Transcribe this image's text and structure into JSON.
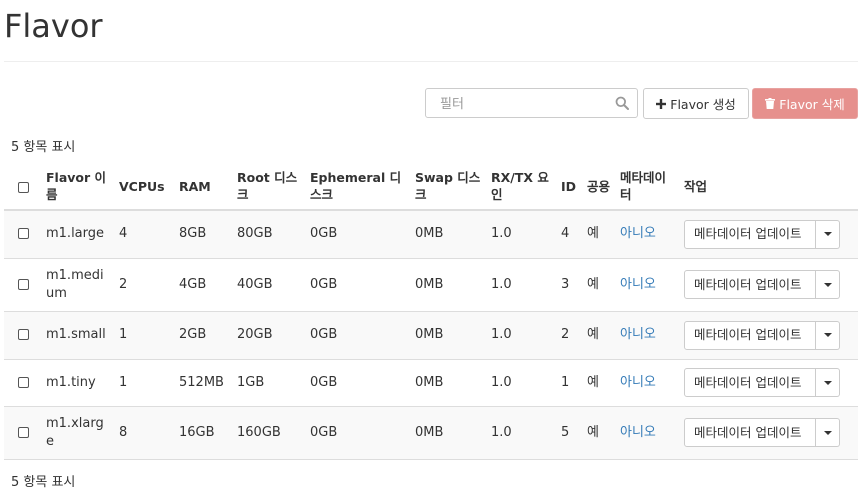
{
  "page": {
    "title": "Flavor"
  },
  "toolbar": {
    "filter_placeholder": "필터",
    "create_label": "Flavor 생성",
    "delete_label": "Flavor 삭제"
  },
  "summary": {
    "count_text": "5 항목 표시"
  },
  "table": {
    "headers": {
      "name": "Flavor 이름",
      "vcpus": "VCPUs",
      "ram": "RAM",
      "root_disk": "Root 디스크",
      "ephemeral": "Ephemeral 디스크",
      "swap": "Swap 디스크",
      "rxtx": "RX/TX 요인",
      "id": "ID",
      "public": "공용",
      "metadata": "메타데이터",
      "actions": "작업"
    },
    "rows": [
      {
        "name": "m1.large",
        "vcpus": "4",
        "ram": "8GB",
        "root": "80GB",
        "ephemeral": "0GB",
        "swap": "0MB",
        "rxtx": "1.0",
        "id": "4",
        "public": "예",
        "metadata": "아니오",
        "action": "메타데이터 업데이트"
      },
      {
        "name": "m1.medium",
        "vcpus": "2",
        "ram": "4GB",
        "root": "40GB",
        "ephemeral": "0GB",
        "swap": "0MB",
        "rxtx": "1.0",
        "id": "3",
        "public": "예",
        "metadata": "아니오",
        "action": "메타데이터 업데이트"
      },
      {
        "name": "m1.small",
        "vcpus": "1",
        "ram": "2GB",
        "root": "20GB",
        "ephemeral": "0GB",
        "swap": "0MB",
        "rxtx": "1.0",
        "id": "2",
        "public": "예",
        "metadata": "아니오",
        "action": "메타데이터 업데이트"
      },
      {
        "name": "m1.tiny",
        "vcpus": "1",
        "ram": "512MB",
        "root": "1GB",
        "ephemeral": "0GB",
        "swap": "0MB",
        "rxtx": "1.0",
        "id": "1",
        "public": "예",
        "metadata": "아니오",
        "action": "메타데이터 업데이트"
      },
      {
        "name": "m1.xlarge",
        "vcpus": "8",
        "ram": "16GB",
        "root": "160GB",
        "ephemeral": "0GB",
        "swap": "0MB",
        "rxtx": "1.0",
        "id": "5",
        "public": "예",
        "metadata": "아니오",
        "action": "메타데이터 업데이트"
      }
    ]
  },
  "colors": {
    "link": "#337ab7",
    "danger": "#e6908d"
  },
  "icons": {
    "search": "search-icon",
    "plus": "plus-icon",
    "trash": "trash-icon",
    "caret": "caret-down-icon"
  }
}
